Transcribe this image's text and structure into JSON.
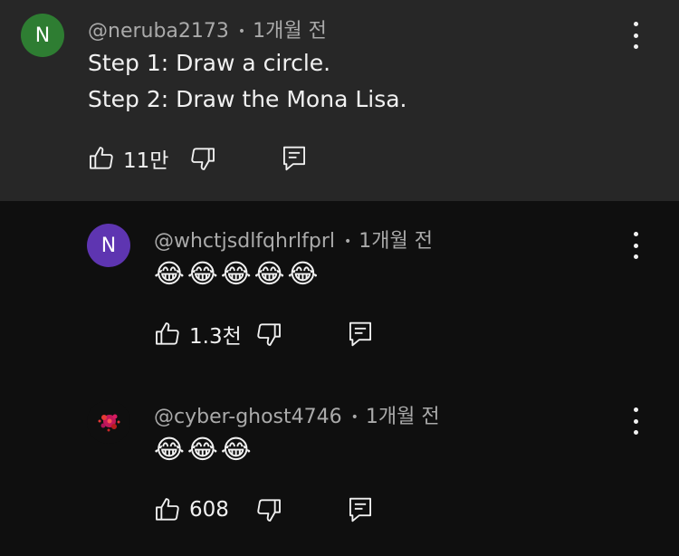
{
  "comments": [
    {
      "avatar_letter": "N",
      "avatar_color": "#2e7d32",
      "username": "@neruba2173",
      "time": "1개월 전",
      "lines": [
        "Step 1: Draw a circle.",
        "Step 2: Draw the Mona Lisa."
      ],
      "likes": "11만"
    },
    {
      "avatar_letter": "N",
      "avatar_color": "#5e35b1",
      "username": "@whctjsdlfqhrlfprl",
      "time": "1개월 전",
      "emoji": "😂😂😂😂😂",
      "likes": "1.3천"
    },
    {
      "avatar_icon": "red-splatter-avatar",
      "username": "@cyber-ghost4746",
      "time": "1개월 전",
      "emoji": "😂😂😂",
      "likes": "608"
    }
  ],
  "separator": "•",
  "colors": {
    "top_comment_bg": "#272727",
    "page_bg": "#0f0f0f",
    "meta_text": "#aaaaaa",
    "body_text": "#f1f1f1"
  },
  "icons": {
    "like": "thumbs-up-icon",
    "dislike": "thumbs-down-icon",
    "reply": "comment-icon",
    "menu": "more-vert-icon"
  }
}
